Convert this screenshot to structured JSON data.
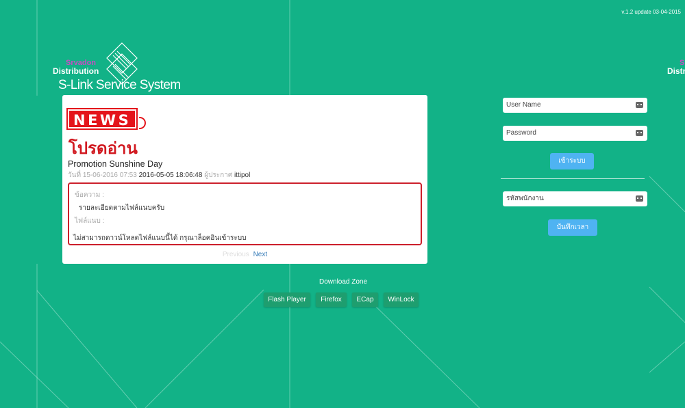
{
  "version": "v.1.2 update 03-04-2015",
  "logo": {
    "brand": "Srvadon",
    "distribution": "Distribution",
    "system_name": "S-Link Service System"
  },
  "news": {
    "badge": "NEWS",
    "subtitle": "โปรดอ่าน",
    "title": "Promotion Sunshine Day",
    "meta": {
      "date_label": "วันที่ 15-06-2016 07:53",
      "updated": "2016-05-05 18:06:48",
      "author_label": "ผู้ประกาศ",
      "author": "ittipol"
    },
    "message_label": "ข้อความ :",
    "message": "รายละเอียดตามไฟล์แนบครับ",
    "attachment_label": "ไฟล์แนบ :",
    "attachment_notice": "ไม่สามารถดาวน์โหลดไฟล์แนบนี้ได้ กรุณาล็อคอินเข้าระบบ",
    "pager": {
      "previous": "Previous",
      "next": "Next"
    }
  },
  "downloads": {
    "title": "Download Zone",
    "buttons": [
      "Flash Player",
      "Firefox",
      "ECap",
      "WinLock"
    ]
  },
  "login": {
    "username_placeholder": "User Name",
    "password_placeholder": "Password",
    "login_button": "เข้าระบบ",
    "employee_placeholder": "รหัสพนักงาน",
    "timestamp_button": "บันทึกเวลา"
  },
  "colors": {
    "background": "#12b287",
    "news_red": "#e4141b",
    "button_blue": "#4fb3f2",
    "download_green": "#1e9e6f"
  }
}
